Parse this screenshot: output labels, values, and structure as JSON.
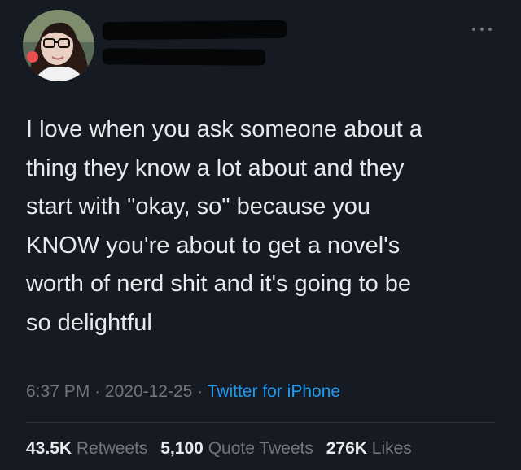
{
  "tweet": {
    "text_lines": [
      "I love when you ask someone about a",
      "thing they know a lot about and they",
      "start with \"okay, so\" because you",
      "KNOW you're about to get a novel's",
      "worth of nerd shit and it's going to be",
      "so delightful"
    ],
    "time": "6:37 PM",
    "separator": "·",
    "date": "2020-12-25",
    "source": "Twitter for iPhone",
    "retweets_count": "43.5K",
    "retweets_label": "Retweets",
    "quotes_count": "5,100",
    "quotes_label": "Quote Tweets",
    "likes_count": "276K",
    "likes_label": "Likes"
  },
  "icons": {
    "more": "more-options-icon"
  },
  "colors": {
    "background": "#151a23",
    "text": "#e7e9ea",
    "muted": "#71767b",
    "link": "#1d9bf0"
  }
}
